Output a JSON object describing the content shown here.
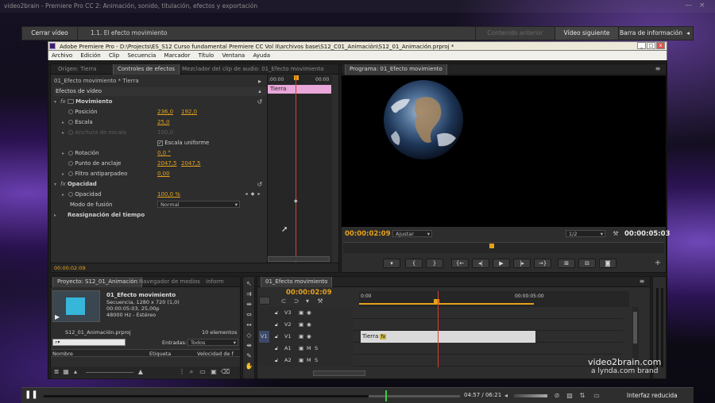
{
  "outer": {
    "title": "video2brain - Premiere Pro CC 2: Animación, sonido, titulación, efectos y exportación",
    "minimize": "—",
    "close": "×",
    "close_video": "Cerrar vídeo",
    "lesson": "1.1. El efecto movimiento",
    "prev_video": "Contenido anterior",
    "next_video": "Vídeo siguiente",
    "info_bar": "Barra de información",
    "info_chevron": "◂"
  },
  "app": {
    "title": "Adobe Premiere Pro - D:\\Projects\\ES_S12 Curso fundamental Premiere CC Vol II\\archivos base\\S12_C01_Animación\\S12_01_Animación.prproj *",
    "menu": [
      "Archivo",
      "Edición",
      "Clip",
      "Secuencia",
      "Marcador",
      "Título",
      "Ventana",
      "Ayuda"
    ]
  },
  "source_panel": {
    "tabs": [
      "Origen: Tierra",
      "Controles de efectos",
      "Mezclador del clip de audio: 01_Efecto movimiento"
    ],
    "header": "01_Efecto movimiento * Tierra",
    "ruler_start": ":00:00",
    "ruler_end": "00:00",
    "clip_label": "Tierra",
    "section": "Efectos de vídeo",
    "motion": "Movimiento",
    "position_label": "Posición",
    "position_x": "236,0",
    "position_y": "192,0",
    "scale_label": "Escala",
    "scale_value": "25,0",
    "scale_width_label": "Anchura de escala",
    "scale_width_value": "100,0",
    "uniform_check": "✓",
    "uniform_label": "Escala uniforme",
    "rotation_label": "Rotación",
    "rotation_value": "0,0 °",
    "anchor_label": "Punto de anclaje",
    "anchor_x": "2047,5",
    "anchor_y": "2047,5",
    "antiflicker_label": "Filtro antiparpadeo",
    "antiflicker_value": "0,00",
    "opacity_section": "Opacidad",
    "opacity_label": "Opacidad",
    "opacity_value": "100,0 %",
    "blend_label": "Modo de fusión",
    "blend_value": "Normal",
    "remap_label": "Reasignación del tiempo",
    "timecode": "00:00:02:09"
  },
  "program": {
    "tab": "Programa: 01_Efecto movimiento",
    "timecode": "00:00:02:09",
    "fit": "Ajustar",
    "resolution": "1/2",
    "duration": "00:00:05:03"
  },
  "project": {
    "tabs": [
      "Proyecto: S12_01_Animación",
      "Navegador de medios",
      "Inform"
    ],
    "seq_name": "01_Efecto movimiento",
    "seq_info1": "Secuencia, 1280 x 720 (1,0)",
    "seq_info2": "00:00:05:03, 25,00p",
    "seq_info3": "48000 Hz - Estéreo",
    "file": "S12_01_Animación.prproj",
    "count": "10 elementos",
    "entries_label": "Entradas:",
    "entries_value": "Todos",
    "col_name": "Nombre",
    "col_label": "Etiqueta",
    "col_speed": "Velocidad de f"
  },
  "timeline": {
    "tab": "01_Efecto movimiento",
    "timecode": "00:00:02:09",
    "ruler_start": "0:00",
    "ruler_mid": "00:00:05:00",
    "tracks": [
      "V3",
      "V2",
      "V1",
      "A1",
      "A2"
    ],
    "v1_source": "V1",
    "clip_label": "Tierra",
    "fx": "fx"
  },
  "watermark": {
    "brand": "video2brain.com",
    "sub": "a lynda.com brand"
  },
  "player": {
    "time": "04:57 / 06:21",
    "reduced": "Interfaz reducida",
    "progress": 0.78
  },
  "colors": {
    "accent_orange": "#e4a21b",
    "clip_pink": "#e8a6d9",
    "playhead_red": "#d9402e",
    "progress_green": "#3ccf3c"
  }
}
